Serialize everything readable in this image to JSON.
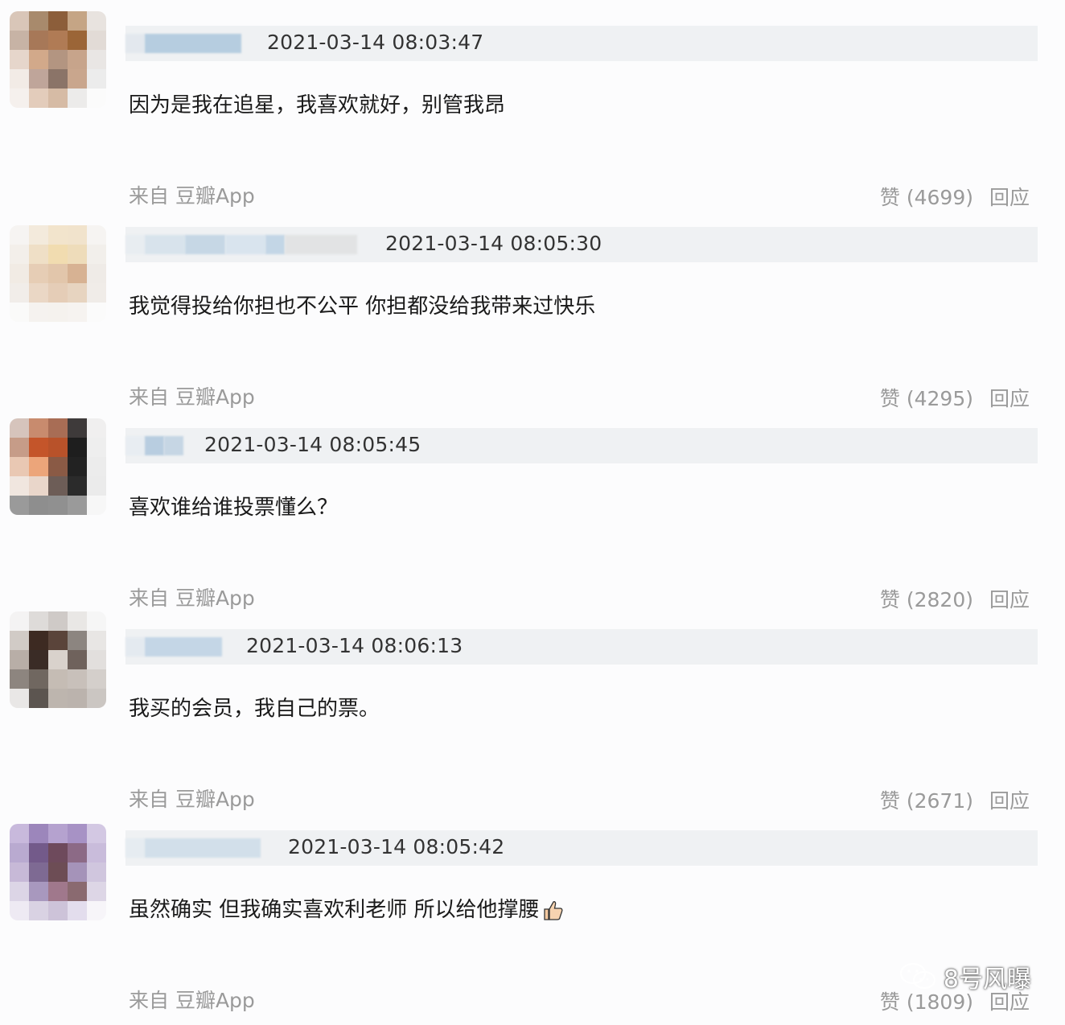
{
  "comments": [
    {
      "timestamp": "2021-03-14 08:03:47",
      "text": "因为是我在追星，我喜欢就好，别管我昂",
      "source": "来自 豆瓣App",
      "like_label": "赞 (4699)",
      "reply_label": "回应"
    },
    {
      "timestamp": "2021-03-14 08:05:30",
      "text": "我觉得投给你担也不公平 你担都没给我带来过快乐",
      "source": "来自 豆瓣App",
      "like_label": "赞 (4295)",
      "reply_label": "回应"
    },
    {
      "timestamp": "2021-03-14 08:05:45",
      "text": "喜欢谁给谁投票懂么？",
      "source": "来自 豆瓣App",
      "like_label": "赞 (2820)",
      "reply_label": "回应"
    },
    {
      "timestamp": "2021-03-14 08:06:13",
      "text": "我买的会员，我自己的票。",
      "source": "来自 豆瓣App",
      "like_label": "赞 (2671)",
      "reply_label": "回应"
    },
    {
      "timestamp": "2021-03-14 08:05:42",
      "text": "虽然确实 但我确实喜欢利老师 所以给他撑腰",
      "source": "来自 豆瓣App",
      "like_label": "赞 (1809)",
      "reply_label": "回应"
    }
  ],
  "watermark": {
    "text": "8号风曝"
  },
  "icons": {
    "thumbs_up": "thumbs-up-icon",
    "wechat": "wechat-icon"
  }
}
